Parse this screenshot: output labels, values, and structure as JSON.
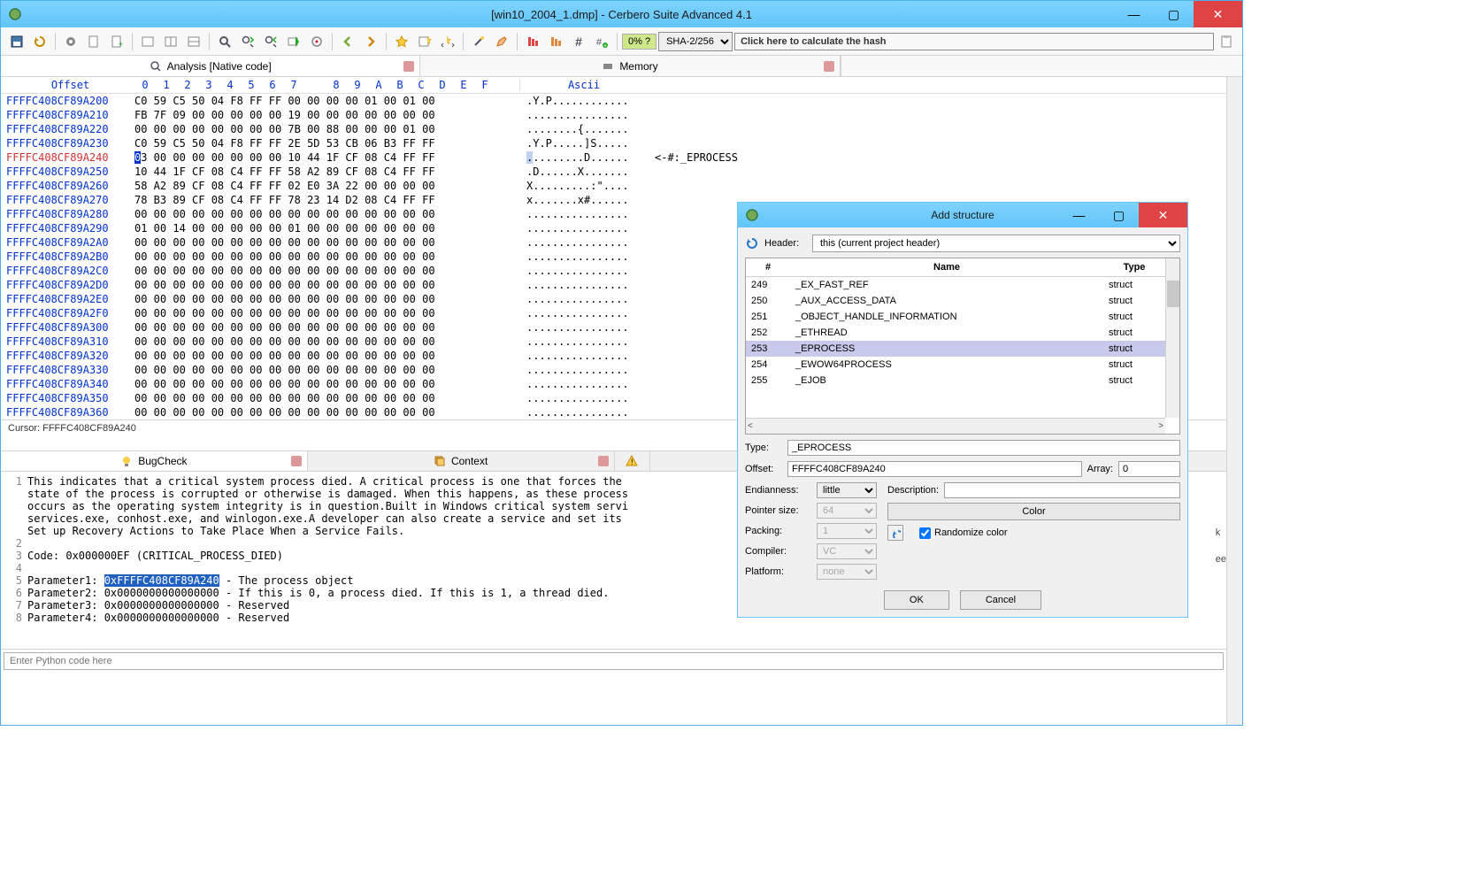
{
  "window": {
    "title": "[win10_2004_1.dmp] - Cerbero Suite Advanced 4.1"
  },
  "toolbar": {
    "percent": "0% ?",
    "hash_algo": "SHA-2/256",
    "hash_hint": "Click here to calculate the hash"
  },
  "tabs": {
    "analysis": "Analysis [Native code]",
    "memory": "Memory"
  },
  "hex": {
    "header_offset": "Offset",
    "header_bytes": [
      "0",
      "1",
      "2",
      "3",
      "4",
      "5",
      "6",
      "7",
      "",
      "8",
      "9",
      "A",
      "B",
      "C",
      "D",
      "E",
      "F"
    ],
    "header_ascii": "Ascii",
    "rows": [
      {
        "addr": "FFFFC408CF89A200",
        "b": "C0 59 C5 50 04 F8 FF FF   00 00 00 00 01 00 01 00",
        "a": ".Y.P............"
      },
      {
        "addr": "FFFFC408CF89A210",
        "b": "FB 7F 09 00 00 00 00 00   19 00 00 00 00 00 00 00",
        "a": "................"
      },
      {
        "addr": "FFFFC408CF89A220",
        "b": "00 00 00 00 00 00 00 00   7B 00 88 00 00 00 01 00",
        "a": "........{......."
      },
      {
        "addr": "FFFFC408CF89A230",
        "b": "C0 59 C5 50 04 F8 FF FF   2E 5D 53 CB 06 B3 FF FF",
        "a": ".Y.P.....]S....."
      },
      {
        "addr": "FFFFC408CF89A240",
        "b": "03 00 00 00 00 00 00 00   10 44 1F CF 08 C4 FF FF",
        "a": ".........D......",
        "hl": true,
        "sel0": true
      },
      {
        "addr": "FFFFC408CF89A250",
        "b": "10 44 1F CF 08 C4 FF FF   58 A2 89 CF 08 C4 FF FF",
        "a": ".D......X......."
      },
      {
        "addr": "FFFFC408CF89A260",
        "b": "58 A2 89 CF 08 C4 FF FF   02 E0 3A 22 00 00 00 00",
        "a": "X.........:\"...."
      },
      {
        "addr": "FFFFC408CF89A270",
        "b": "78 B3 89 CF 08 C4 FF FF   78 23 14 D2 08 C4 FF FF",
        "a": "x.......x#......"
      },
      {
        "addr": "FFFFC408CF89A280",
        "b": "00 00 00 00 00 00 00 00   00 00 00 00 00 00 00 00",
        "a": "................"
      },
      {
        "addr": "FFFFC408CF89A290",
        "b": "01 00 14 00 00 00 00 00   01 00 00 00 00 00 00 00",
        "a": "................"
      },
      {
        "addr": "FFFFC408CF89A2A0",
        "b": "00 00 00 00 00 00 00 00   00 00 00 00 00 00 00 00",
        "a": "................"
      },
      {
        "addr": "FFFFC408CF89A2B0",
        "b": "00 00 00 00 00 00 00 00   00 00 00 00 00 00 00 00",
        "a": "................"
      },
      {
        "addr": "FFFFC408CF89A2C0",
        "b": "00 00 00 00 00 00 00 00   00 00 00 00 00 00 00 00",
        "a": "................"
      },
      {
        "addr": "FFFFC408CF89A2D0",
        "b": "00 00 00 00 00 00 00 00   00 00 00 00 00 00 00 00",
        "a": "................"
      },
      {
        "addr": "FFFFC408CF89A2E0",
        "b": "00 00 00 00 00 00 00 00   00 00 00 00 00 00 00 00",
        "a": "................"
      },
      {
        "addr": "FFFFC408CF89A2F0",
        "b": "00 00 00 00 00 00 00 00   00 00 00 00 00 00 00 00",
        "a": "................"
      },
      {
        "addr": "FFFFC408CF89A300",
        "b": "00 00 00 00 00 00 00 00   00 00 00 00 00 00 00 00",
        "a": "................"
      },
      {
        "addr": "FFFFC408CF89A310",
        "b": "00 00 00 00 00 00 00 00   00 00 00 00 00 00 00 00",
        "a": "................"
      },
      {
        "addr": "FFFFC408CF89A320",
        "b": "00 00 00 00 00 00 00 00   00 00 00 00 00 00 00 00",
        "a": "................"
      },
      {
        "addr": "FFFFC408CF89A330",
        "b": "00 00 00 00 00 00 00 00   00 00 00 00 00 00 00 00",
        "a": "................"
      },
      {
        "addr": "FFFFC408CF89A340",
        "b": "00 00 00 00 00 00 00 00   00 00 00 00 00 00 00 00",
        "a": "................"
      },
      {
        "addr": "FFFFC408CF89A350",
        "b": "00 00 00 00 00 00 00 00   00 00 00 00 00 00 00 00",
        "a": "................"
      },
      {
        "addr": "FFFFC408CF89A360",
        "b": "00 00 00 00 00 00 00 00   00 00 00 00 00 00 00 00",
        "a": "................"
      }
    ],
    "annotation": "<-#:_EPROCESS",
    "cursor": "Cursor: FFFFC408CF89A240"
  },
  "mid_tabs": {
    "bugcheck": "BugCheck",
    "context": "Context"
  },
  "bugcheck": {
    "lines": [
      "This indicates that a critical system process died. A critical process is one that forces the",
      "state of the process is corrupted or otherwise is damaged. When this happens, as these process",
      "occurs as the operating system integrity is in question.Built in Windows critical system servi",
      "services.exe, conhost.exe, and winlogon.exe.A developer can also create a service and set its ",
      "Set up Recovery Actions to Take Place When a Service Fails.",
      "",
      "Code: 0x000000EF (CRITICAL_PROCESS_DIED)",
      "",
      "Parameter1: 0xFFFFC408CF89A240 - The process object",
      "Parameter2: 0x0000000000000000 - If this is 0, a process died. If this is 1, a thread died.",
      "Parameter3: 0x0000000000000000 - Reserved",
      "Parameter4: 0x0000000000000000 - Reserved"
    ],
    "hl_text": "0xFFFFC408CF89A240"
  },
  "python": {
    "placeholder": "Enter Python code here"
  },
  "dialog": {
    "title": "Add structure",
    "header_label": "Header:",
    "header_value": "this (current project header)",
    "cols": {
      "num": "#",
      "name": "Name",
      "type": "Type"
    },
    "structs": [
      {
        "n": "249",
        "name": "_EX_FAST_REF",
        "type": "struct"
      },
      {
        "n": "250",
        "name": "_AUX_ACCESS_DATA",
        "type": "struct"
      },
      {
        "n": "251",
        "name": "_OBJECT_HANDLE_INFORMATION",
        "type": "struct"
      },
      {
        "n": "252",
        "name": "_ETHREAD",
        "type": "struct"
      },
      {
        "n": "253",
        "name": "_EPROCESS",
        "type": "struct",
        "sel": true
      },
      {
        "n": "254",
        "name": "_EWOW64PROCESS",
        "type": "struct"
      },
      {
        "n": "255",
        "name": "_EJOB",
        "type": "struct"
      }
    ],
    "type_label": "Type:",
    "type_value": "_EPROCESS",
    "offset_label": "Offset:",
    "offset_value": "FFFFC408CF89A240",
    "array_label": "Array:",
    "array_value": "0",
    "endian_label": "Endianness:",
    "endian_value": "little",
    "ptr_label": "Pointer size:",
    "ptr_value": "64",
    "packing_label": "Packing:",
    "packing_value": "1",
    "compiler_label": "Compiler:",
    "compiler_value": "VC",
    "platform_label": "Platform:",
    "platform_value": "none",
    "desc_label": "Description:",
    "color_label": "Color",
    "randomize": "Randomize color",
    "ok": "OK",
    "cancel": "Cancel"
  },
  "right_panel": {
    "line1": "k",
    "line2": "ee"
  }
}
